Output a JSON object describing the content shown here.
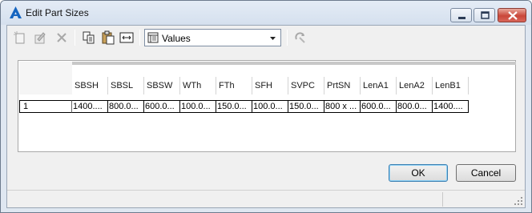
{
  "window": {
    "title": "Edit Part Sizes",
    "accent": "#1565c0"
  },
  "toolbar": {
    "icons": [
      "new-row-icon",
      "edit-row-icon",
      "delete-icon",
      "copy-icon",
      "paste-icon",
      "fit-columns-icon",
      "refresh-icon"
    ],
    "view_select": {
      "value": "Values",
      "icon": "table-values-icon"
    }
  },
  "grid": {
    "columns": [
      "SBSH",
      "SBSL",
      "SBSW",
      "WTh",
      "FTh",
      "SFH",
      "SVPC",
      "PrtSN",
      "LenA1",
      "LenA2",
      "LenB1"
    ],
    "rows": [
      {
        "row_number": "1",
        "cells": [
          "1400....",
          "800.0...",
          "600.0...",
          "100.0...",
          "150.0...",
          "100.0...",
          "150.0...",
          "800 x ...",
          "600.0...",
          "800.0...",
          "1400...."
        ]
      }
    ]
  },
  "buttons": {
    "ok": "OK",
    "cancel": "Cancel"
  }
}
